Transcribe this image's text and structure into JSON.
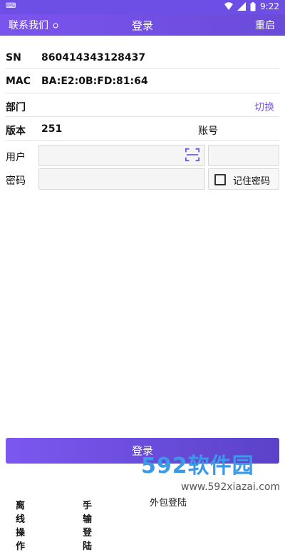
{
  "status": {
    "time": "9:22",
    "left_glyph": "⌨"
  },
  "appbar": {
    "contact": "联系我们",
    "title": "登录",
    "restart": "重启"
  },
  "fields": {
    "sn_label": "SN",
    "sn_value": "860414343128437",
    "mac_label": "MAC",
    "mac_value": "BA:E2:0B:FD:81:64",
    "dept_label": "部门",
    "switch_label": "切换",
    "version_label": "版本",
    "version_value": "251",
    "account_label": "账号",
    "user_label": "用户",
    "user_value": "",
    "password_label": "密码",
    "password_value": "",
    "remember_label": "记住密码"
  },
  "login_button": "登录",
  "bottom_nav": [
    {
      "label": "离线操作",
      "chevron": "›"
    },
    {
      "label": "手输登陆",
      "chevron": "›"
    },
    {
      "label": "外包登陆"
    }
  ],
  "watermark": {
    "brand": "592软件园",
    "url": "www.592xiazai.com"
  },
  "colors": {
    "accent": "#7b57f0",
    "appbar": "#6e4fe6"
  }
}
